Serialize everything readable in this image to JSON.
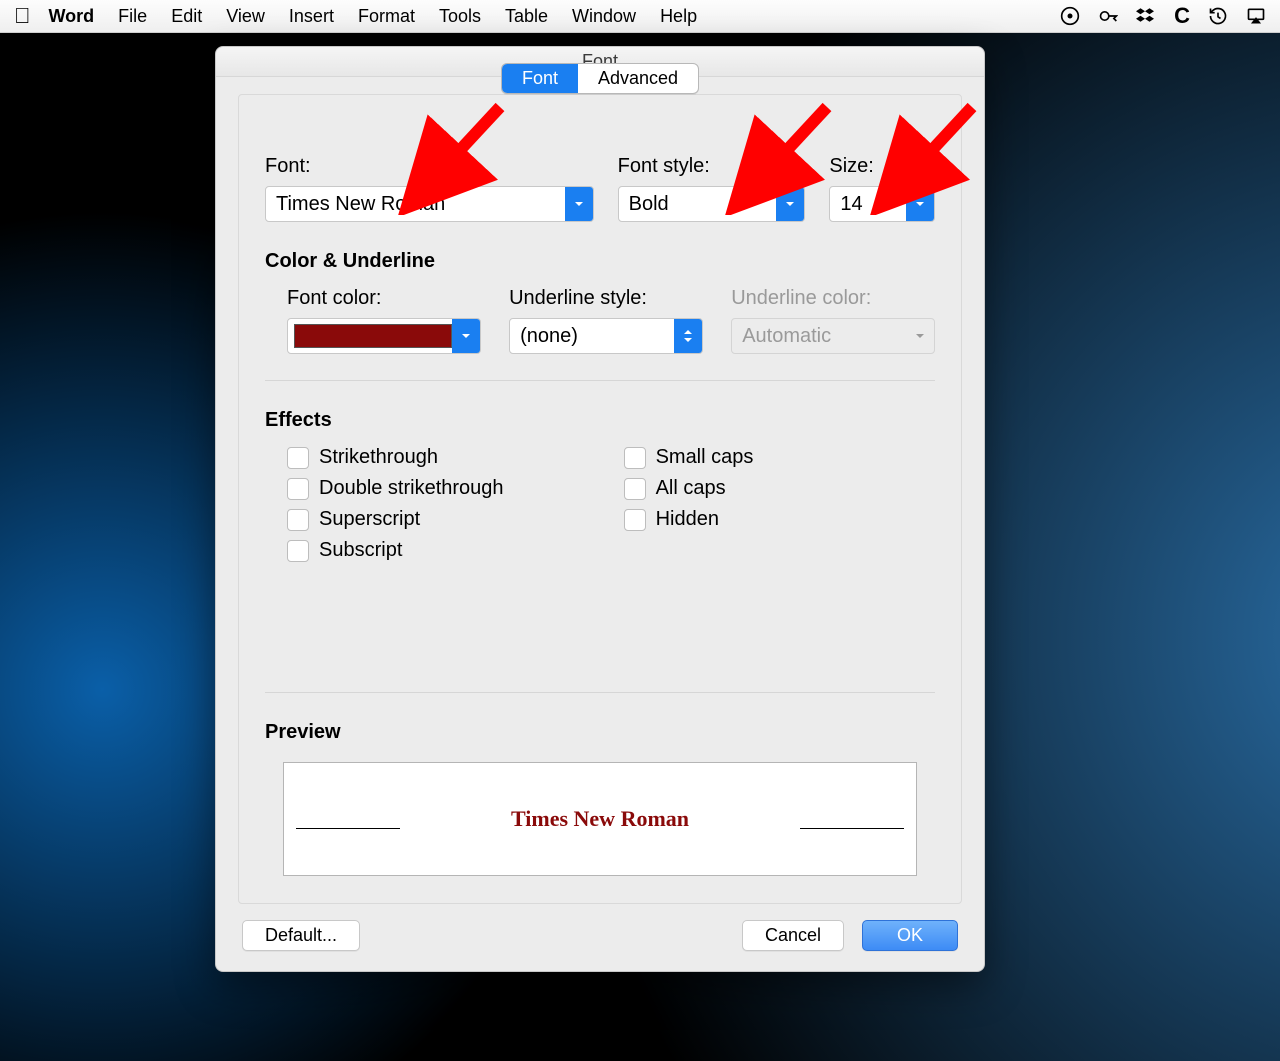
{
  "menubar": {
    "app": "Word",
    "items": [
      "File",
      "Edit",
      "View",
      "Insert",
      "Format",
      "Tools",
      "Table",
      "Window",
      "Help"
    ]
  },
  "dialog": {
    "title": "Font",
    "tabs": {
      "font": "Font",
      "advanced": "Advanced"
    },
    "labels": {
      "font": "Font:",
      "style": "Font style:",
      "size": "Size:",
      "colorUnderline": "Color & Underline",
      "fontColor": "Font color:",
      "underlineStyle": "Underline style:",
      "underlineColor": "Underline color:",
      "effects": "Effects",
      "preview": "Preview"
    },
    "values": {
      "font": "Times New Roman",
      "style": "Bold",
      "size": "14",
      "underlineStyle": "(none)",
      "underlineColor": "Automatic",
      "fontColorHex": "#8a0a0a"
    },
    "effects": {
      "left": [
        "Strikethrough",
        "Double strikethrough",
        "Superscript",
        "Subscript"
      ],
      "right": [
        "Small caps",
        "All caps",
        "Hidden"
      ]
    },
    "preview_text": "Times New Roman",
    "buttons": {
      "default": "Default...",
      "cancel": "Cancel",
      "ok": "OK"
    }
  }
}
